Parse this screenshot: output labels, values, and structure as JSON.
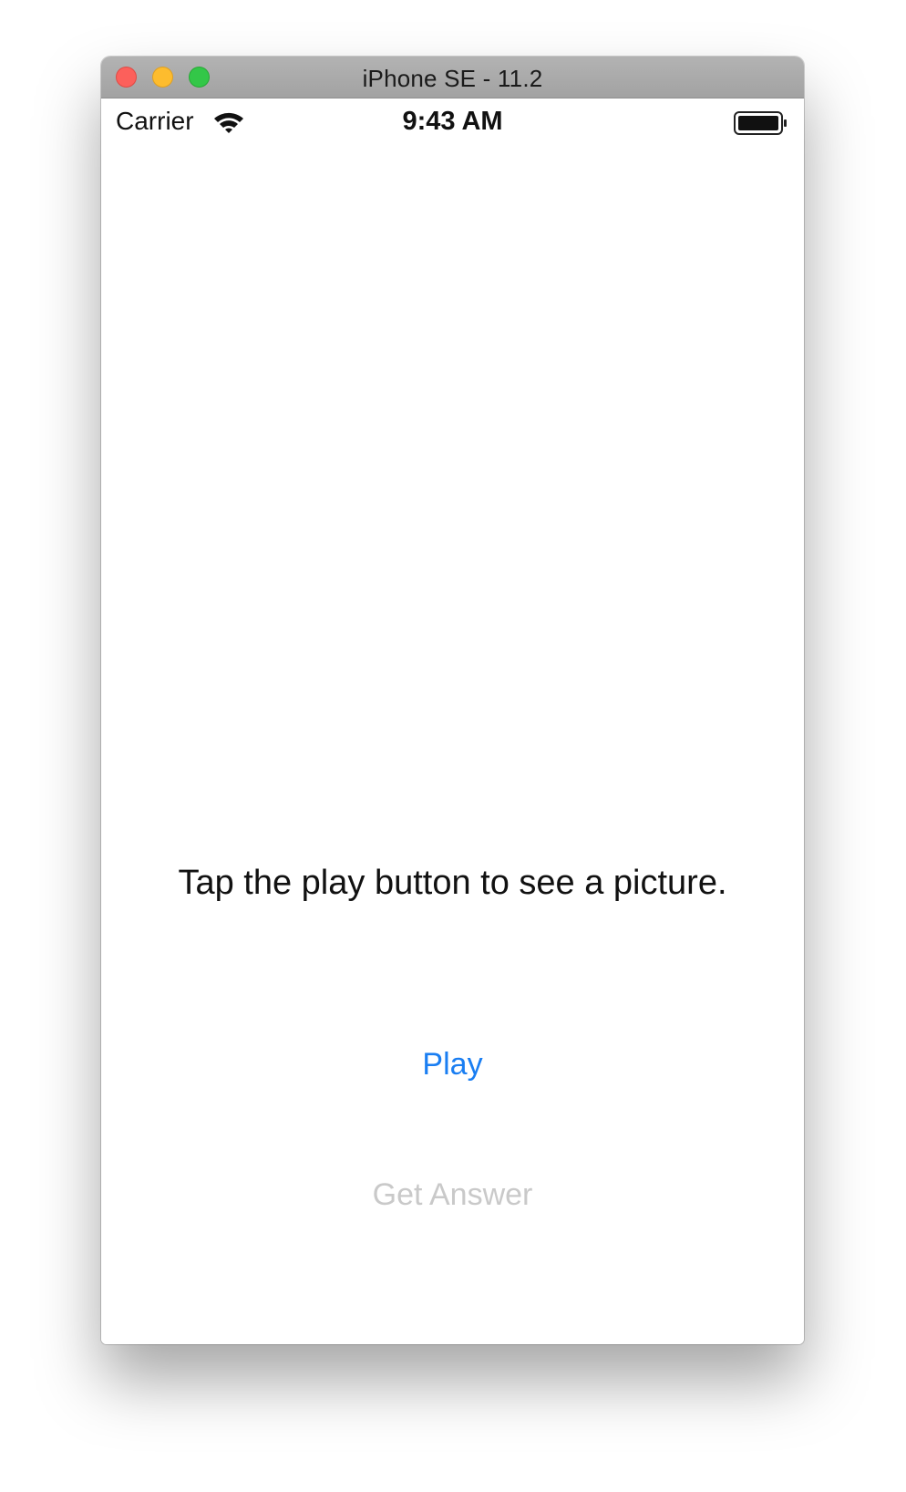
{
  "window": {
    "title": "iPhone SE - 11.2"
  },
  "status_bar": {
    "carrier": "Carrier",
    "time": "9:43 AM",
    "icons": [
      "wifi-icon",
      "battery-icon"
    ]
  },
  "main": {
    "prompt": "Tap the play button to see a picture.",
    "play_label": "Play",
    "answer_label": "Get Answer",
    "answer_enabled": false
  },
  "colors": {
    "tint": "#1a7ef2",
    "disabled": "#c9c9c9",
    "close": "#fc605b",
    "minimize": "#fdbc2e",
    "zoom": "#33c748"
  }
}
